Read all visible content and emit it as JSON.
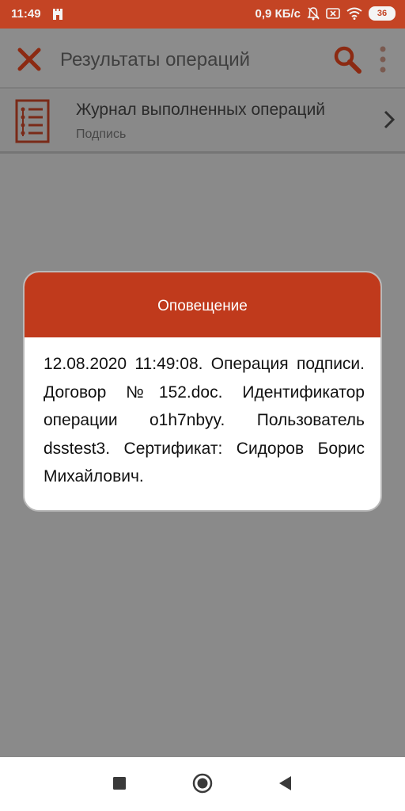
{
  "status_bar": {
    "time": "11:49",
    "speed": "0,9 КБ/с",
    "battery": "36",
    "icons": [
      "app-notification-icon",
      "mute-bell-icon",
      "sim-icon",
      "wifi-icon",
      "battery-icon"
    ]
  },
  "app_bar": {
    "title": "Результаты операций",
    "icons": [
      "close-icon",
      "search-icon",
      "more-vert-icon"
    ]
  },
  "list": {
    "items": [
      {
        "title": "Журнал выполненных операций",
        "subtitle": "Подпись",
        "icon": "journal-list-icon"
      }
    ]
  },
  "dialog": {
    "title": "Оповещение",
    "message": "12.08.2020 11:49:08. Операция подписи. Договор №152.doc. Идентификатор операции o1h7nbyy. Пользователь dsstest3. Сертификат: Сидоров Борис Михайлович."
  },
  "nav_bar": {
    "icons": [
      "recents-square-icon",
      "home-circle-icon",
      "back-triangle-icon"
    ]
  },
  "colors": {
    "accent": "#c44424",
    "dialog_header": "#c03a1c",
    "scrim": "#8a8a8a"
  }
}
